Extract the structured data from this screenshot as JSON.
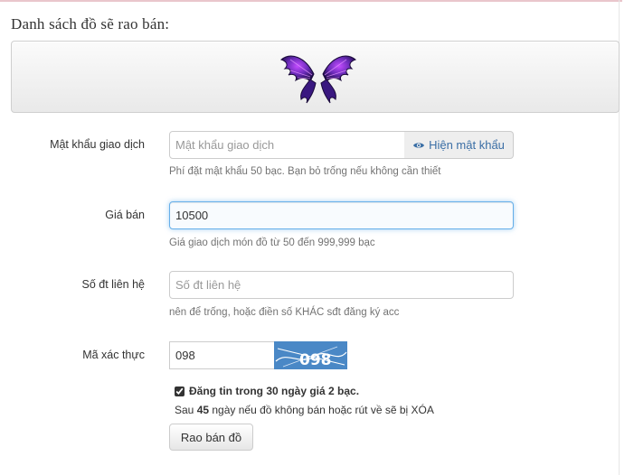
{
  "section_title": "Danh sách đồ sẽ rao bán:",
  "item": {
    "icon": "purple-wings-icon"
  },
  "password": {
    "label": "Mật khẩu giao dịch",
    "placeholder": "Mật khẩu giao dịch",
    "value": "",
    "show_button_label": "Hiện mật khẩu",
    "show_button_icon": "eye-icon",
    "help": "Phí đặt mật khẩu 50 bạc. Bạn bỏ trống nếu không cần thiết"
  },
  "price": {
    "label": "Giá bán",
    "value": "10500",
    "help": "Giá giao dịch món đồ từ 50 đến 999,999 bạc"
  },
  "phone": {
    "label": "Số đt liên hệ",
    "placeholder": "Số đt liên hệ",
    "value": "",
    "help": "nên để trống, hoặc điền số KHÁC sđt đăng ký acc"
  },
  "captcha": {
    "label": "Mã xác thực",
    "value": "098",
    "image_text": "098",
    "image_bg": "#4a88c6"
  },
  "listing": {
    "checked": true,
    "checkbox_prefix": "Đăng tin trong 30 ngày giá ",
    "checkbox_price": "2 bạc.",
    "note_prefix": "Sau ",
    "note_days": "45",
    "note_suffix": " ngày nếu đồ không bán hoặc rút về sẽ bị XÓA"
  },
  "submit_label": "Rao bán đồ",
  "colors": {
    "focus_border": "#66afe9",
    "link_blue": "#3a6ea5",
    "wing_purple": "#5b2a9e"
  }
}
